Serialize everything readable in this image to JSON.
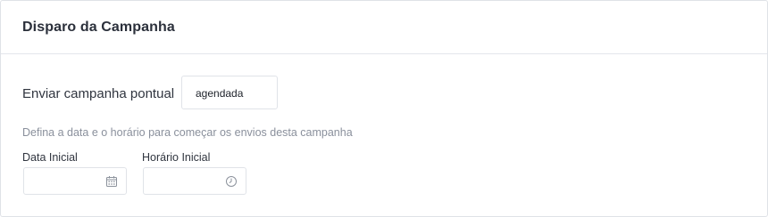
{
  "card": {
    "title": "Disparo da Campanha"
  },
  "send": {
    "label": "Enviar campanha pontual",
    "mode_value": "agendada"
  },
  "helper_text": "Defina a data e o horário para começar os envios desta campanha",
  "start_date": {
    "label": "Data Inicial",
    "value": "",
    "icon": "calendar-icon"
  },
  "start_time": {
    "label": "Horário Inicial",
    "value": "",
    "icon": "clock-icon"
  },
  "colors": {
    "border": "#e0e3e8",
    "title": "#2b303b",
    "helper": "#8a909c",
    "icon": "#8b919b"
  }
}
